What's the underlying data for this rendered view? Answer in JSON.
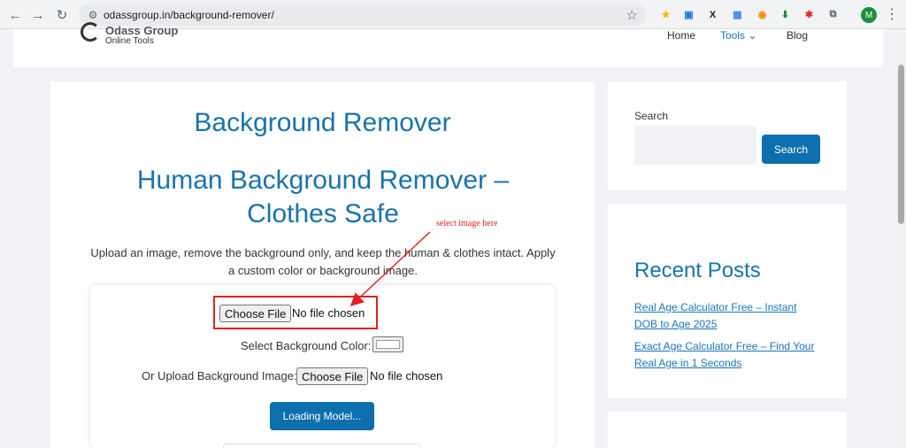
{
  "browser": {
    "url": "odassgroup.in/background-remover/",
    "profile_initial": "M",
    "nav_back": "←",
    "nav_forward": "→",
    "nav_reload": "↻",
    "star": "☆",
    "menu": "⋮",
    "extensions": [
      {
        "name": "ext-yellow",
        "glyph": "★",
        "color": "#f5b400"
      },
      {
        "name": "ext-blue-square",
        "glyph": "▣",
        "color": "#1a73e8"
      },
      {
        "name": "ext-x",
        "glyph": "X",
        "color": "#202124"
      },
      {
        "name": "ext-image",
        "glyph": "▦",
        "color": "#4285f4"
      },
      {
        "name": "ext-orange",
        "glyph": "◉",
        "color": "#f28b00"
      },
      {
        "name": "ext-green-arrow",
        "glyph": "⬇",
        "color": "#1e8e3e"
      },
      {
        "name": "ext-red",
        "glyph": "✱",
        "color": "#d93025"
      },
      {
        "name": "ext-puzzle",
        "glyph": "⧉",
        "color": "#5f6368"
      }
    ]
  },
  "header": {
    "logo_title": "Odass Group",
    "logo_subtitle": "Online Tools",
    "menu": [
      {
        "label": "Home"
      },
      {
        "label": "Tools ⌄"
      },
      {
        "label": "Blog"
      }
    ]
  },
  "main": {
    "title": "Background Remover",
    "subtitle": "Human Background Remover – Clothes Safe",
    "description": "Upload an image, remove the background only, and keep the human & clothes intact. Apply a custom color or background image.",
    "file_button": "Choose File",
    "file_status": "No file chosen",
    "bg_color_label": "Select Background Color:",
    "bg_image_label": "Or Upload Background Image:",
    "bg_file_button": "Choose File",
    "bg_file_status": "No file chosen",
    "load_button": "Loading Model..."
  },
  "annotation": {
    "text": "select image here",
    "color": "#e02020"
  },
  "sidebar": {
    "search_label": "Search",
    "search_button": "Search",
    "recent_title": "Recent Posts",
    "posts": [
      {
        "title": "Real Age Calculator Free – Instant DOB to Age 2025"
      },
      {
        "title": "Exact Age Calculator Free – Find Your Real Age in 1 Seconds"
      }
    ]
  },
  "colors": {
    "accent": "#1a73a8",
    "button": "#0d6fae"
  }
}
